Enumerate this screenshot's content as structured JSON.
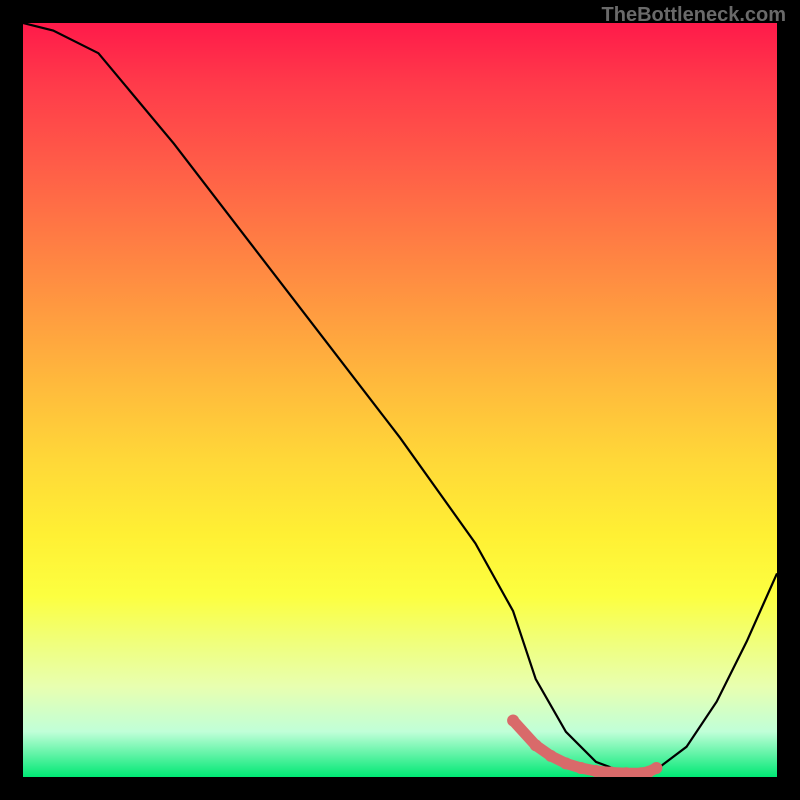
{
  "watermark": "TheBottleneck.com",
  "chart_data": {
    "type": "line",
    "title": "",
    "xlabel": "",
    "ylabel": "",
    "xlim": [
      0,
      100
    ],
    "ylim": [
      0,
      100
    ],
    "series": [
      {
        "name": "curve",
        "x": [
          0,
          4,
          10,
          20,
          30,
          40,
          50,
          60,
          65,
          68,
          72,
          76,
          80,
          82,
          84,
          88,
          92,
          96,
          100
        ],
        "values": [
          100,
          99,
          96,
          84,
          71,
          58,
          45,
          31,
          22,
          13,
          6,
          2,
          0.5,
          0.5,
          1,
          4,
          10,
          18,
          27
        ]
      }
    ],
    "markers": {
      "name": "highlight-points",
      "x": [
        65,
        68,
        70,
        72,
        74,
        76,
        78,
        80,
        82,
        83,
        84
      ],
      "values": [
        7.5,
        4.2,
        2.8,
        1.8,
        1.2,
        0.8,
        0.6,
        0.5,
        0.5,
        0.7,
        1.2
      ]
    },
    "background_gradient": {
      "top": "#ff1a4a",
      "mid": "#fff034",
      "bottom": "#00e874"
    }
  }
}
